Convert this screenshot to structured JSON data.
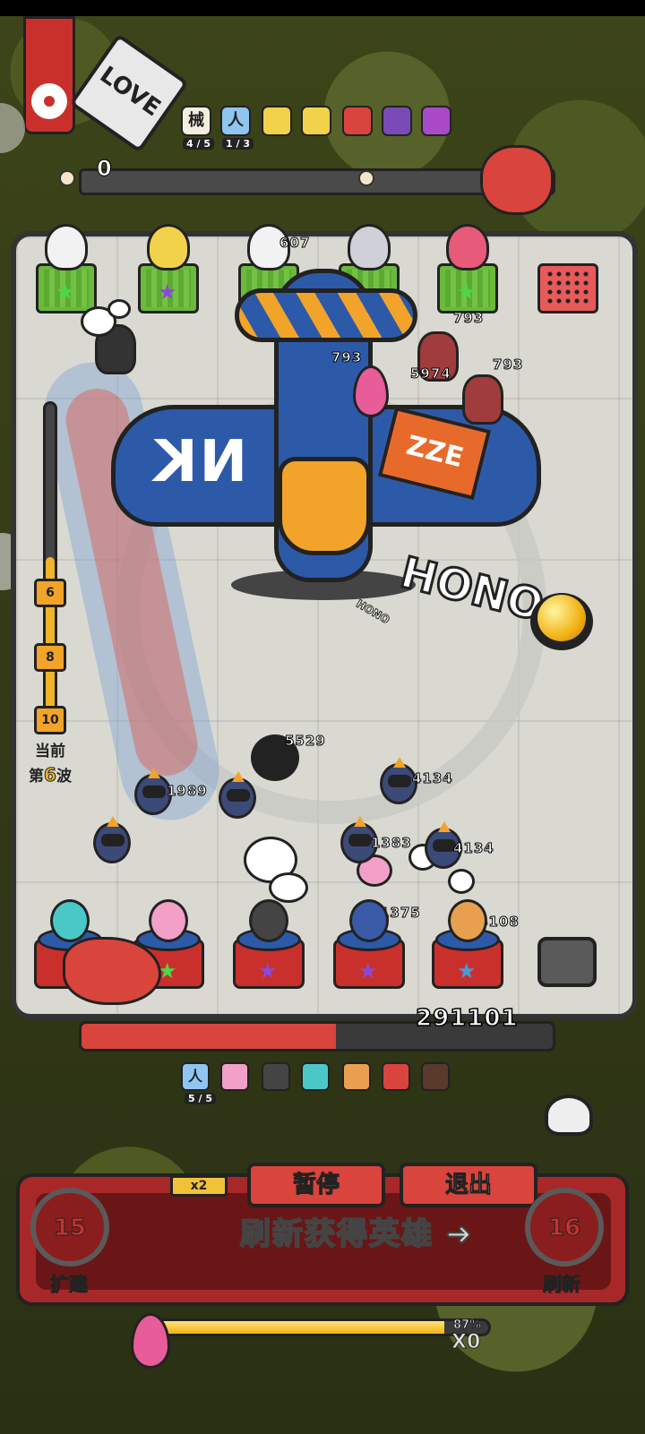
{
  "top": {
    "score": "0",
    "buffs": [
      {
        "icon": "machine-icon",
        "label": "械",
        "count": "4 / 5",
        "color": "#f2efe0"
      },
      {
        "icon": "human-icon",
        "label": "人",
        "count": "1 / 3",
        "color": "#8fc6f0"
      },
      {
        "icon": "mask-icon",
        "label": "",
        "color": "#f2d24a"
      },
      {
        "icon": "lightning-icon",
        "label": "",
        "color": "#f2d24a"
      },
      {
        "icon": "dice-icon",
        "label": "",
        "color": "#d9443c"
      },
      {
        "icon": "fan-icon",
        "label": "",
        "color": "#7a4ab8"
      },
      {
        "icon": "badge-icon",
        "label": "",
        "color": "#a84ac8"
      }
    ]
  },
  "board": {
    "top_units": [
      {
        "name": "chef-robot",
        "star": "★",
        "star_color": "#4ad84a",
        "color": "#f2f2f2"
      },
      {
        "name": "clown-king",
        "star": "★",
        "star_color": "#8a4ad8",
        "color": "#f2d24a"
      },
      {
        "name": "cannon-robot",
        "star": "",
        "star_color": "#4ad84a",
        "color": "#f2f2f2"
      },
      {
        "name": "helmet-robot",
        "star": "",
        "star_color": "#4ad84a",
        "color": "#d0d0d8"
      },
      {
        "name": "rider-unit",
        "star": "★",
        "star_color": "#4ad84a",
        "color": "#e85a7a"
      },
      {
        "name": "watermelon-box",
        "star": "",
        "star_color": "#4ad84a",
        "color": "#e85a5a"
      }
    ],
    "damage_numbers": [
      {
        "value": "607"
      },
      {
        "value": "793"
      },
      {
        "value": "793"
      },
      {
        "value": "5974"
      },
      {
        "value": "793"
      },
      {
        "value": "5529"
      },
      {
        "value": "1989"
      },
      {
        "value": "4134"
      },
      {
        "value": "1383"
      },
      {
        "value": "4134"
      },
      {
        "value": "1375"
      },
      {
        "value": "4108"
      }
    ],
    "plane_text": "NK",
    "plane_badge": "ZZE",
    "hono_text": "HONO",
    "hono_small": "HONO",
    "bottom_units": [
      {
        "name": "teal-hair-hero",
        "star": "",
        "star_color": "#4ad84a",
        "color": "#4ac8c8"
      },
      {
        "name": "pink-bunny-hero",
        "star": "★",
        "star_color": "#4ad84a",
        "color": "#f2a0c8"
      },
      {
        "name": "dark-hero",
        "star": "★",
        "star_color": "#8a4ad8",
        "color": "#444444"
      },
      {
        "name": "samurai-hero",
        "star": "★",
        "star_color": "#8a4ad8",
        "color": "#3a5aa8"
      },
      {
        "name": "brawler-hero",
        "star": "★",
        "star_color": "#4a9ad8",
        "color": "#e8a050"
      }
    ]
  },
  "wave": {
    "gifts": [
      "6",
      "8",
      "10"
    ],
    "label_current": "当前",
    "label_prefix": "第",
    "label_number": "6",
    "label_suffix": "波",
    "progress": 0.5
  },
  "hp": {
    "value": "291101",
    "fraction": 0.54
  },
  "roster": {
    "count": "5 / 5",
    "items": [
      {
        "icon": "human-icon",
        "label": "人",
        "color": "#8fc6f0"
      },
      {
        "icon": "girl-icon",
        "label": "",
        "color": "#f2a0c8"
      },
      {
        "icon": "shadow-icon",
        "label": "",
        "color": "#444444"
      },
      {
        "icon": "teal-icon",
        "label": "",
        "color": "#4ac8c8"
      },
      {
        "icon": "brawler-icon",
        "label": "",
        "color": "#e8a050"
      },
      {
        "icon": "oni-icon",
        "label": "",
        "color": "#d9443c"
      },
      {
        "icon": "wheel-icon",
        "label": "",
        "color": "#5a3a2a"
      }
    ]
  },
  "controls": {
    "speed": "x2",
    "pause": "暂停",
    "exit": "退出",
    "hint": "刷新获得英雄",
    "expand_cost": "15",
    "expand_label": "扩建",
    "refresh_cost": "16",
    "refresh_label": "刷新"
  },
  "energy": {
    "percent": "87%",
    "fraction": 0.87,
    "multiplier": "X0"
  }
}
